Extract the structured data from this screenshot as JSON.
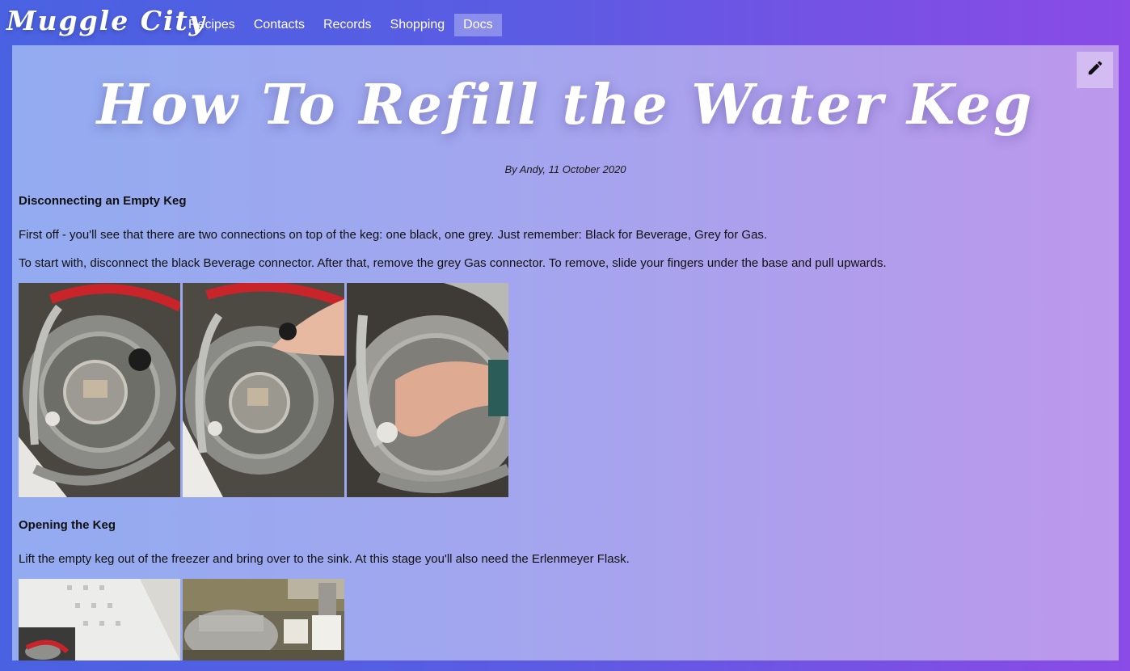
{
  "site": {
    "brand": "Muggle City"
  },
  "nav": {
    "items": [
      {
        "label": "Recipes",
        "active": false
      },
      {
        "label": "Contacts",
        "active": false
      },
      {
        "label": "Records",
        "active": false
      },
      {
        "label": "Shopping",
        "active": false
      },
      {
        "label": "Docs",
        "active": true
      }
    ]
  },
  "doc": {
    "title": "How To Refill the Water Keg",
    "byline": "By Andy, 11 October 2020",
    "sections": [
      {
        "heading": "Disconnecting an Empty Keg",
        "paragraphs": [
          "First off - you'll see that there are two connections on top of the keg: one black, one grey. Just remember: Black for Beverage, Grey for Gas.",
          "To start with, disconnect the black Beverage connector. After that, remove the grey Gas connector. To remove, slide your fingers under the base and pull upwards."
        ]
      },
      {
        "heading": "Opening the Keg",
        "paragraphs": [
          "Lift the empty keg out of the freezer and bring over to the sink. At this stage you'll also need the Erlenmeyer Flask."
        ]
      }
    ]
  },
  "icons": {
    "edit": "pencil-icon"
  }
}
